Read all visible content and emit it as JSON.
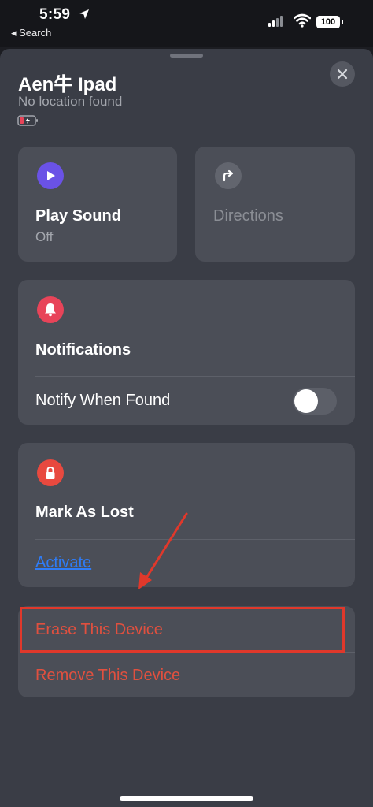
{
  "status_bar": {
    "time": "5:59",
    "back_label": "◂ Search",
    "battery_level": "100"
  },
  "device": {
    "name": "Aen牛 Ipad",
    "location_status": "No location found"
  },
  "actions": {
    "play_sound": {
      "title": "Play Sound",
      "status": "Off"
    },
    "directions": {
      "title": "Directions"
    }
  },
  "notifications": {
    "title": "Notifications",
    "notify_when_found_label": "Notify When Found",
    "notify_when_found_on": false
  },
  "mark_as_lost": {
    "title": "Mark As Lost",
    "activate_label": "Activate"
  },
  "device_management": {
    "erase_label": "Erase This Device",
    "remove_label": "Remove This Device"
  },
  "colors": {
    "accent_purple": "#6a52e6",
    "notification_red": "#e84459",
    "lost_red": "#e8493f",
    "destructive_text": "#e0503f",
    "link_blue": "#2f7cf6",
    "annotation_red": "#e0382b"
  },
  "icons": [
    "location-arrow-icon",
    "signal-icon",
    "wifi-icon",
    "battery-icon",
    "battery-low-icon",
    "close-icon",
    "play-icon",
    "directions-icon",
    "bell-icon",
    "lock-icon"
  ]
}
